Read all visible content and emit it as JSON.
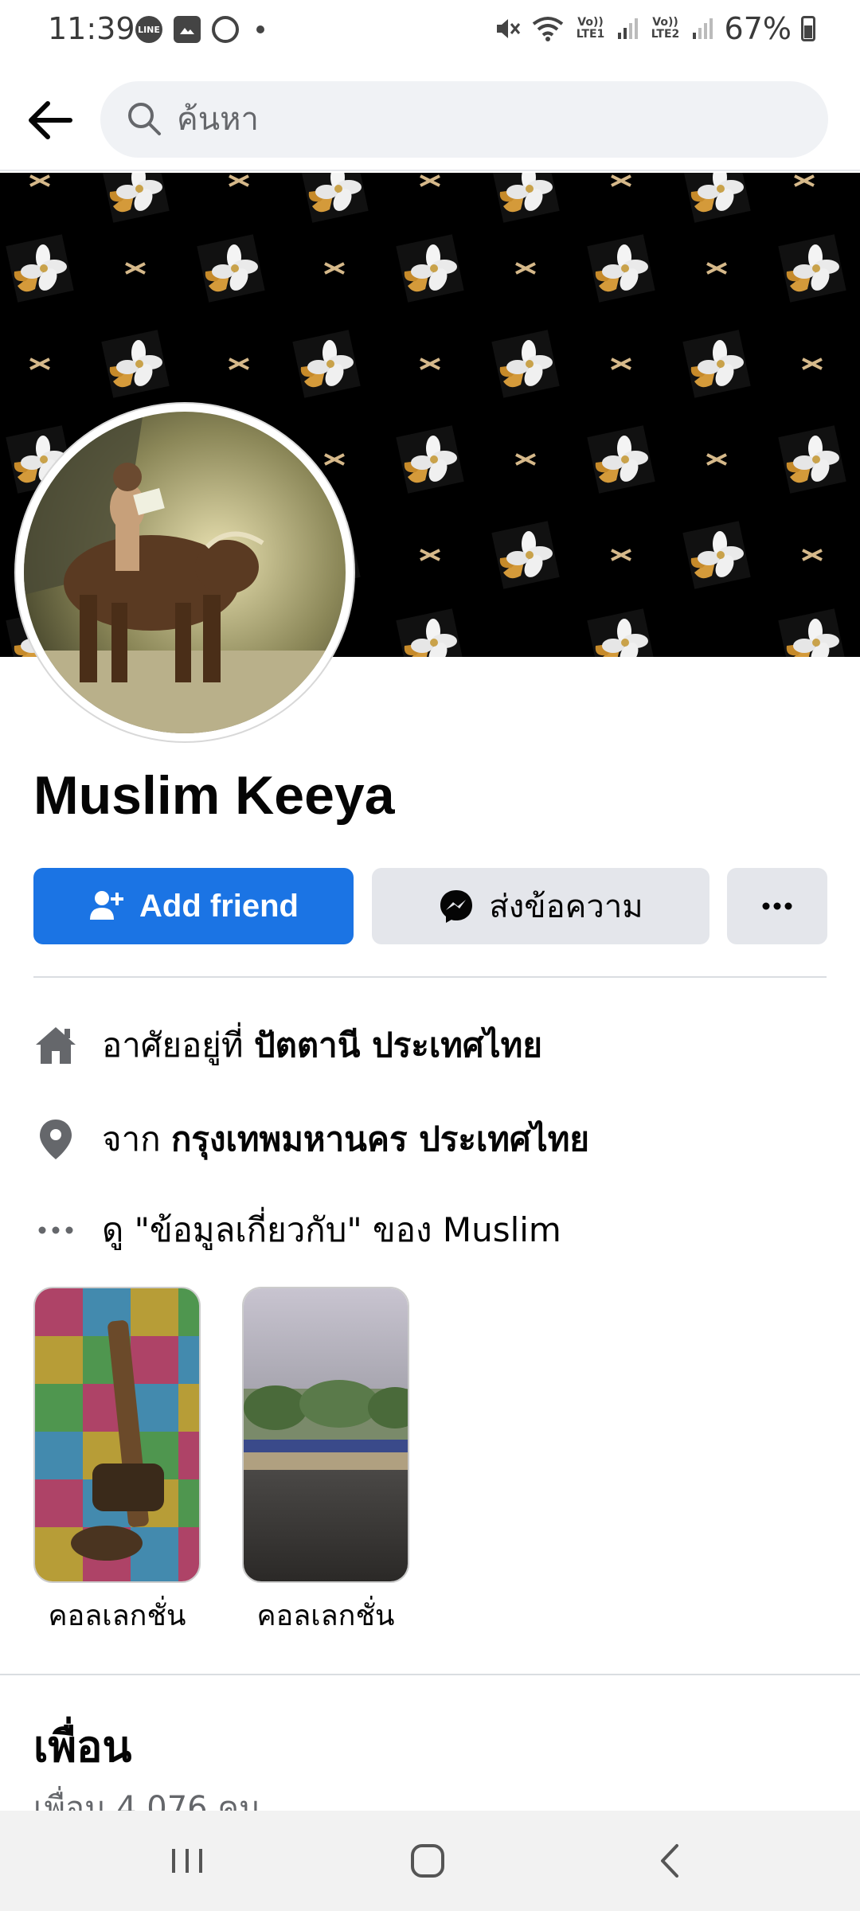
{
  "status_bar": {
    "time": "11:39",
    "left_icons": [
      "line-icon",
      "gallery-icon",
      "timer-icon",
      "dot-icon"
    ],
    "volte1": "Vo)) LTE1",
    "volte2": "Vo)) LTE2",
    "battery_percent": "67%",
    "battery_level": 0.67
  },
  "header": {
    "search_placeholder": "ค้นหา"
  },
  "profile": {
    "name": "Muslim Keeya"
  },
  "actions": {
    "add_friend": "Add friend",
    "message": "ส่งข้อความ"
  },
  "intro": {
    "lives_prefix": "อาศัยอยู่ที่ ",
    "lives_place": "ปัตตานี ประเทศไทย",
    "from_prefix": "จาก ",
    "from_place": "กรุงเทพมหานคร ประเทศไทย",
    "about_link": "ดู \"ข้อมูลเกี่ยวกับ\" ของ Muslim"
  },
  "collections": [
    {
      "label": "คอลเลกชั่น"
    },
    {
      "label": "คอลเลกชั่น"
    }
  ],
  "friends": {
    "title": "เพื่อน",
    "count": "เพื่อน 4,076 คน"
  },
  "colors": {
    "accent": "#1b74e4",
    "secondary_button": "#e4e6eb",
    "text": "#050505",
    "muted_text": "#65676b"
  }
}
